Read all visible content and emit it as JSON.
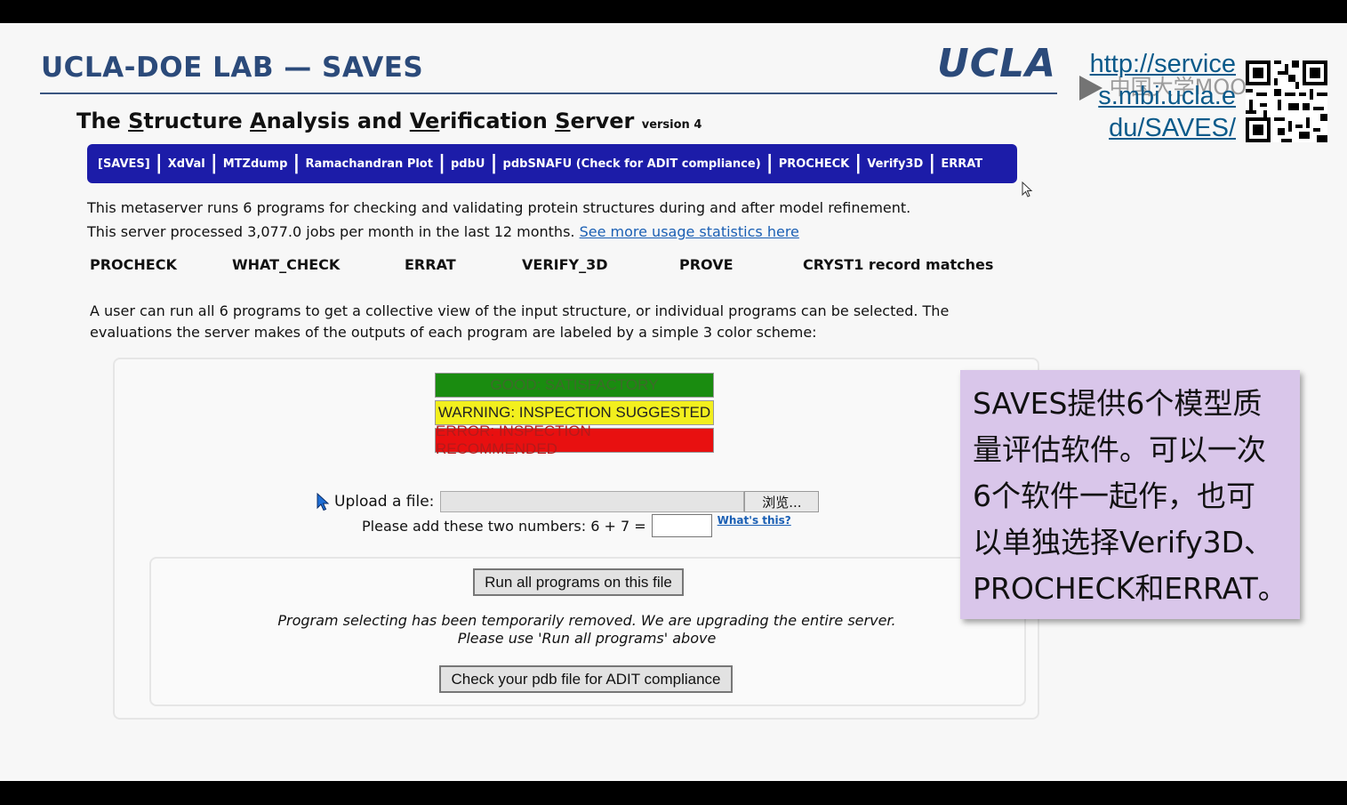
{
  "header": {
    "site_title": "UCLA-DOE LAB — SAVES",
    "logo_text": "UCLA"
  },
  "server_title": {
    "prefix_1": "The ",
    "s_letter": "S",
    "word_1_rest": "tructure ",
    "a_letter": "A",
    "word_2_rest": "nalysis and ",
    "v_letters": "Ve",
    "word_3_rest": "rification ",
    "s2_letter": "S",
    "word_4_rest": "erver",
    "version": "version 4"
  },
  "nav": {
    "items": [
      "[SAVES]",
      "XdVal",
      "MTZdump",
      "Ramachandran Plot",
      "pdbU",
      "pdbSNAFU (Check for ADIT compliance)",
      "PROCHECK",
      "Verify3D",
      "ERRAT"
    ],
    "separator": "|",
    "bg_color": "#1c1ca8"
  },
  "intro": {
    "line_1": "This metaserver runs 6 programs for checking and validating protein structures during and after model refinement.",
    "line_2": "This server processed 3,077.0 jobs per month in the last 12 months.",
    "stats_link": "See more usage statistics here"
  },
  "programs": [
    "PROCHECK",
    "WHAT_CHECK",
    "ERRAT",
    "VERIFY_3D",
    "PROVE",
    "CRYST1 record matches"
  ],
  "description": "A user can run all 6 programs to get a collective view of the input structure, or individual programs can be selected. The evaluations the server makes of the outputs of each program are labeled by a simple 3 color scheme:",
  "legend": {
    "good": "GOOD: SATISFACTORY",
    "warning": "WARNING: INSPECTION SUGGESTED",
    "error": "ERROR: INSPECTION RECOMMENDED",
    "good_color": "#1a8c10",
    "warning_color": "#f2ef1e",
    "error_color": "#e81010"
  },
  "upload": {
    "label": "Upload a file:",
    "browse_label": "浏览..."
  },
  "captcha": {
    "label": "Please add these two numbers: 6 + 7 =",
    "answer": "",
    "help_link": "What's this?"
  },
  "actions": {
    "run_all": "Run all programs on this file",
    "notice_line_1": "Program selecting has been temporarily removed. We are upgrading the entire server.",
    "notice_line_2": "Please use 'Run all programs' above",
    "adit_check": "Check your pdb file for ADIT compliance"
  },
  "overlay": {
    "url_lines": [
      "http://service",
      "s.mbi.ucla.e",
      "du/SAVES/"
    ],
    "watermark": "中国大学MOOC",
    "callout_lines": [
      "SAVES提供6个模型质",
      "量评估软件。可以一次",
      "6个软件一起作，也可",
      "以单独选择Verify3D、",
      "PROCHECK和ERRAT。"
    ],
    "callout_color": "#d9c6ea"
  }
}
